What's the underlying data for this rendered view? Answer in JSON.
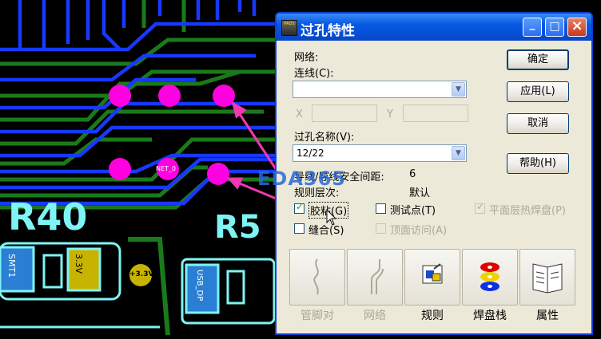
{
  "canvas": {
    "designators": {
      "r40": "R40",
      "r5": "R5"
    },
    "labels": {
      "net_small": "NET_0",
      "pad_3v3": "+3.3V",
      "chip_a": "3.3V",
      "chip_b": "SMT1",
      "chip_c": "USB_DP"
    },
    "watermark": "EDA365"
  },
  "dialog": {
    "title": "过孔特性",
    "title_icon_text": "PADS",
    "window_buttons": {
      "minimize": "_",
      "maximize": "□",
      "close": "×"
    },
    "net_label": "网络:",
    "connect_label": "连线(C):",
    "connect_value": "",
    "x_label": "X",
    "y_label": "Y",
    "via_name_label": "过孔名称(V):",
    "via_name_value": "12/22",
    "clearance_label": "导线/导线安全间距:",
    "clearance_value": "6",
    "rule_level_label": "规则层次:",
    "rule_level_value": "默认",
    "checkboxes": {
      "glue": {
        "label": "胶粘(G)",
        "checked": true
      },
      "test_point": {
        "label": "测试点(T)",
        "checked": false
      },
      "plane_thermal": {
        "label": "平面层热焊盘(P)",
        "checked": true
      },
      "stitch": {
        "label": "缝合(S)",
        "checked": false
      },
      "top_access": {
        "label": "顶面访问(A)",
        "checked": false
      }
    },
    "buttons": {
      "ok": "确定",
      "apply": "应用(L)",
      "cancel": "取消",
      "help": "帮助(H)"
    },
    "bottom_buttons": [
      {
        "label": "管脚对",
        "icon": "pin-pair-icon",
        "enabled": false
      },
      {
        "label": "网络",
        "icon": "net-icon",
        "enabled": false
      },
      {
        "label": "规则",
        "icon": "rules-icon",
        "enabled": true
      },
      {
        "label": "焊盘栈",
        "icon": "pad-stack-icon",
        "enabled": true
      },
      {
        "label": "属性",
        "icon": "attributes-icon",
        "enabled": true
      }
    ]
  },
  "colors": {
    "trace_blue": "#1838ff",
    "trace_green": "#1a7a1a",
    "silk_cyan": "#7ff4f4",
    "via_magenta": "#ff00e0",
    "arrow_pink": "#f038b0",
    "title_blue": "#0758e2"
  }
}
